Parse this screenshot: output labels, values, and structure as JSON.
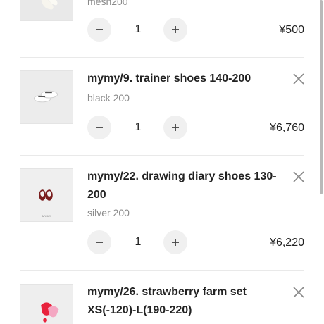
{
  "cart": {
    "items": [
      {
        "title": "",
        "variant": "mesh200",
        "quantity": "1",
        "price": "¥500",
        "image_icon": "socks-product-image"
      },
      {
        "title": "mymy/9. trainer shoes 140-200",
        "variant": "black 200",
        "quantity": "1",
        "price": "¥6,760",
        "image_icon": "white-trainer-shoes-image"
      },
      {
        "title_line1": "mymy/22. drawing diary shoes 130-",
        "title_line2": "200",
        "variant": "silver 200",
        "quantity": "1",
        "price": "¥6,220",
        "image_icon": "red-mary-jane-shoes-image",
        "image_caption": "MY MY"
      },
      {
        "title_line1": "mymy/26. strawberry farm set",
        "title_line2": "XS(-120)-L(190-220)",
        "image_icon": "strawberry-set-image"
      }
    ],
    "icons": {
      "decrease": "minus-icon",
      "increase": "plus-icon",
      "remove": "close-icon"
    }
  }
}
